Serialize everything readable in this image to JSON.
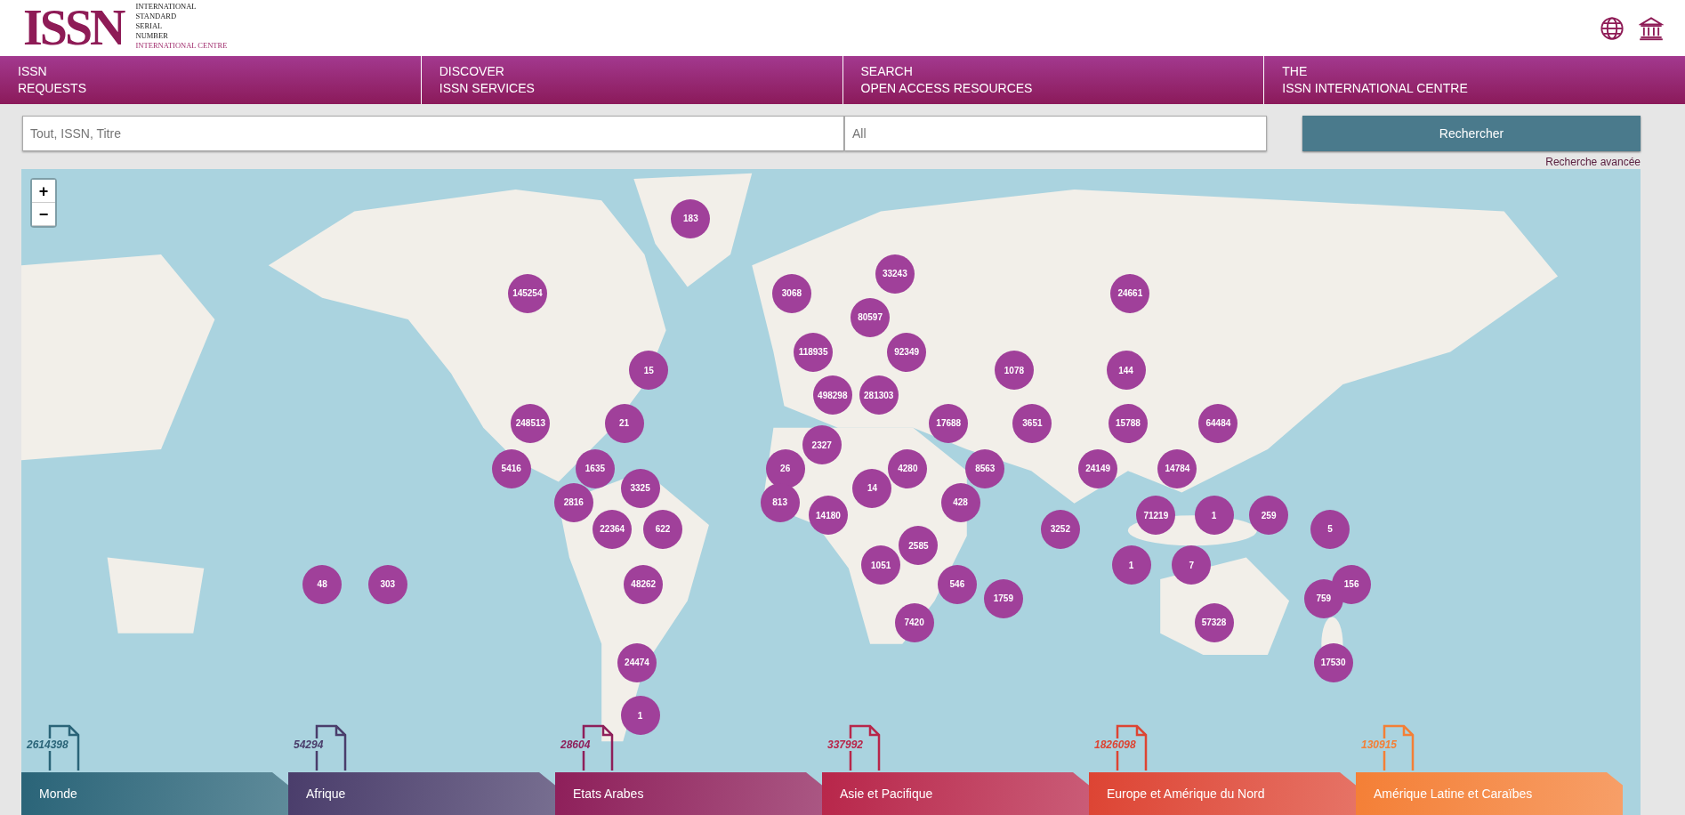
{
  "logo": {
    "mark": "ISSN",
    "lines": [
      "INTERNATIONAL",
      "STANDARD",
      "SERIAL",
      "NUMBER"
    ],
    "centre": "INTERNATIONAL CENTRE"
  },
  "nav": [
    {
      "line1": "ISSN",
      "line2": "REQUESTS"
    },
    {
      "line1": "DISCOVER",
      "line2": "ISSN SERVICES"
    },
    {
      "line1": "SEARCH",
      "line2": "OPEN ACCESS RESOURCES"
    },
    {
      "line1": "THE",
      "line2": "ISSN INTERNATIONAL CENTRE"
    }
  ],
  "search": {
    "placeholder": "Tout, ISSN, Titre",
    "filter_placeholder": "All",
    "button": "Rechercher",
    "advanced_link": "Recherche avancée"
  },
  "map": {
    "zoom_in": "+",
    "zoom_out": "−",
    "clusters": [
      {
        "count": "183"
      },
      {
        "count": "33243"
      },
      {
        "count": "145254"
      },
      {
        "count": "3068"
      },
      {
        "count": "24661"
      },
      {
        "count": "80597"
      },
      {
        "count": "118935"
      },
      {
        "count": "92349"
      },
      {
        "count": "15"
      },
      {
        "count": "1078"
      },
      {
        "count": "144"
      },
      {
        "count": "498298"
      },
      {
        "count": "281303"
      },
      {
        "count": "248513"
      },
      {
        "count": "21"
      },
      {
        "count": "17688"
      },
      {
        "count": "3651"
      },
      {
        "count": "15788"
      },
      {
        "count": "64484"
      },
      {
        "count": "2327"
      },
      {
        "count": "5416"
      },
      {
        "count": "1635"
      },
      {
        "count": "26"
      },
      {
        "count": "4280"
      },
      {
        "count": "8563"
      },
      {
        "count": "24149"
      },
      {
        "count": "14784"
      },
      {
        "count": "3325"
      },
      {
        "count": "14"
      },
      {
        "count": "2816"
      },
      {
        "count": "813"
      },
      {
        "count": "428"
      },
      {
        "count": "14180"
      },
      {
        "count": "71219"
      },
      {
        "count": "1"
      },
      {
        "count": "259"
      },
      {
        "count": "22364"
      },
      {
        "count": "622"
      },
      {
        "count": "3252"
      },
      {
        "count": "5"
      },
      {
        "count": "2585"
      },
      {
        "count": "1051"
      },
      {
        "count": "1"
      },
      {
        "count": "7"
      },
      {
        "count": "48"
      },
      {
        "count": "303"
      },
      {
        "count": "48262"
      },
      {
        "count": "546"
      },
      {
        "count": "156"
      },
      {
        "count": "1759"
      },
      {
        "count": "759"
      },
      {
        "count": "7420"
      },
      {
        "count": "57328"
      },
      {
        "count": "24474"
      },
      {
        "count": "17530"
      },
      {
        "count": "1"
      }
    ]
  },
  "regions": [
    {
      "name": "Monde",
      "count": "2614398",
      "color": "#2a6478"
    },
    {
      "name": "Afrique",
      "count": "54294",
      "color": "#4a3d6b"
    },
    {
      "name": "Etats Arabes",
      "count": "28604",
      "color": "#8e1f5a"
    },
    {
      "name": "Asie et Pacifique",
      "count": "337992",
      "color": "#b8264a"
    },
    {
      "name": "Europe et Amérique du Nord",
      "count": "1826098",
      "color": "#dd4433"
    },
    {
      "name": "Amérique Latine et Caraïbes",
      "count": "130915",
      "color": "#f47f36"
    }
  ]
}
